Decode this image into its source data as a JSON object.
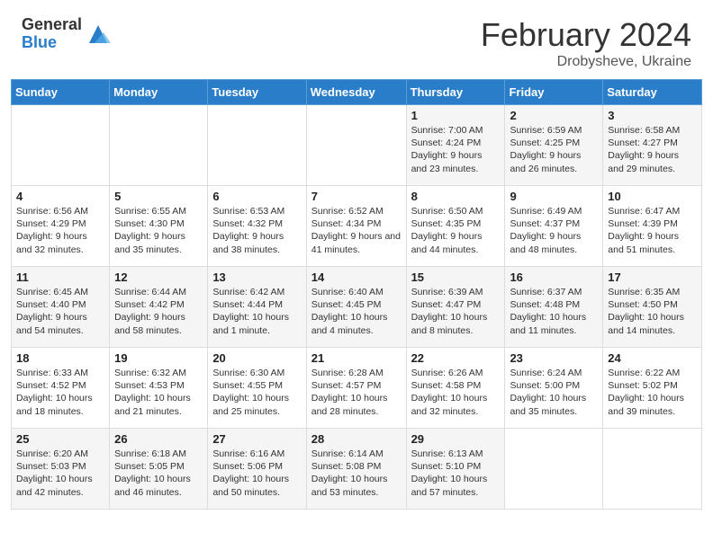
{
  "header": {
    "logo_general": "General",
    "logo_blue": "Blue",
    "month_year": "February 2024",
    "location": "Drobysheve, Ukraine"
  },
  "days_of_week": [
    "Sunday",
    "Monday",
    "Tuesday",
    "Wednesday",
    "Thursday",
    "Friday",
    "Saturday"
  ],
  "weeks": [
    [
      {
        "day": "",
        "detail": ""
      },
      {
        "day": "",
        "detail": ""
      },
      {
        "day": "",
        "detail": ""
      },
      {
        "day": "",
        "detail": ""
      },
      {
        "day": "1",
        "detail": "Sunrise: 7:00 AM\nSunset: 4:24 PM\nDaylight: 9 hours\nand 23 minutes."
      },
      {
        "day": "2",
        "detail": "Sunrise: 6:59 AM\nSunset: 4:25 PM\nDaylight: 9 hours\nand 26 minutes."
      },
      {
        "day": "3",
        "detail": "Sunrise: 6:58 AM\nSunset: 4:27 PM\nDaylight: 9 hours\nand 29 minutes."
      }
    ],
    [
      {
        "day": "4",
        "detail": "Sunrise: 6:56 AM\nSunset: 4:29 PM\nDaylight: 9 hours\nand 32 minutes."
      },
      {
        "day": "5",
        "detail": "Sunrise: 6:55 AM\nSunset: 4:30 PM\nDaylight: 9 hours\nand 35 minutes."
      },
      {
        "day": "6",
        "detail": "Sunrise: 6:53 AM\nSunset: 4:32 PM\nDaylight: 9 hours\nand 38 minutes."
      },
      {
        "day": "7",
        "detail": "Sunrise: 6:52 AM\nSunset: 4:34 PM\nDaylight: 9 hours\nand 41 minutes."
      },
      {
        "day": "8",
        "detail": "Sunrise: 6:50 AM\nSunset: 4:35 PM\nDaylight: 9 hours\nand 44 minutes."
      },
      {
        "day": "9",
        "detail": "Sunrise: 6:49 AM\nSunset: 4:37 PM\nDaylight: 9 hours\nand 48 minutes."
      },
      {
        "day": "10",
        "detail": "Sunrise: 6:47 AM\nSunset: 4:39 PM\nDaylight: 9 hours\nand 51 minutes."
      }
    ],
    [
      {
        "day": "11",
        "detail": "Sunrise: 6:45 AM\nSunset: 4:40 PM\nDaylight: 9 hours\nand 54 minutes."
      },
      {
        "day": "12",
        "detail": "Sunrise: 6:44 AM\nSunset: 4:42 PM\nDaylight: 9 hours\nand 58 minutes."
      },
      {
        "day": "13",
        "detail": "Sunrise: 6:42 AM\nSunset: 4:44 PM\nDaylight: 10 hours\nand 1 minute."
      },
      {
        "day": "14",
        "detail": "Sunrise: 6:40 AM\nSunset: 4:45 PM\nDaylight: 10 hours\nand 4 minutes."
      },
      {
        "day": "15",
        "detail": "Sunrise: 6:39 AM\nSunset: 4:47 PM\nDaylight: 10 hours\nand 8 minutes."
      },
      {
        "day": "16",
        "detail": "Sunrise: 6:37 AM\nSunset: 4:48 PM\nDaylight: 10 hours\nand 11 minutes."
      },
      {
        "day": "17",
        "detail": "Sunrise: 6:35 AM\nSunset: 4:50 PM\nDaylight: 10 hours\nand 14 minutes."
      }
    ],
    [
      {
        "day": "18",
        "detail": "Sunrise: 6:33 AM\nSunset: 4:52 PM\nDaylight: 10 hours\nand 18 minutes."
      },
      {
        "day": "19",
        "detail": "Sunrise: 6:32 AM\nSunset: 4:53 PM\nDaylight: 10 hours\nand 21 minutes."
      },
      {
        "day": "20",
        "detail": "Sunrise: 6:30 AM\nSunset: 4:55 PM\nDaylight: 10 hours\nand 25 minutes."
      },
      {
        "day": "21",
        "detail": "Sunrise: 6:28 AM\nSunset: 4:57 PM\nDaylight: 10 hours\nand 28 minutes."
      },
      {
        "day": "22",
        "detail": "Sunrise: 6:26 AM\nSunset: 4:58 PM\nDaylight: 10 hours\nand 32 minutes."
      },
      {
        "day": "23",
        "detail": "Sunrise: 6:24 AM\nSunset: 5:00 PM\nDaylight: 10 hours\nand 35 minutes."
      },
      {
        "day": "24",
        "detail": "Sunrise: 6:22 AM\nSunset: 5:02 PM\nDaylight: 10 hours\nand 39 minutes."
      }
    ],
    [
      {
        "day": "25",
        "detail": "Sunrise: 6:20 AM\nSunset: 5:03 PM\nDaylight: 10 hours\nand 42 minutes."
      },
      {
        "day": "26",
        "detail": "Sunrise: 6:18 AM\nSunset: 5:05 PM\nDaylight: 10 hours\nand 46 minutes."
      },
      {
        "day": "27",
        "detail": "Sunrise: 6:16 AM\nSunset: 5:06 PM\nDaylight: 10 hours\nand 50 minutes."
      },
      {
        "day": "28",
        "detail": "Sunrise: 6:14 AM\nSunset: 5:08 PM\nDaylight: 10 hours\nand 53 minutes."
      },
      {
        "day": "29",
        "detail": "Sunrise: 6:13 AM\nSunset: 5:10 PM\nDaylight: 10 hours\nand 57 minutes."
      },
      {
        "day": "",
        "detail": ""
      },
      {
        "day": "",
        "detail": ""
      }
    ]
  ]
}
